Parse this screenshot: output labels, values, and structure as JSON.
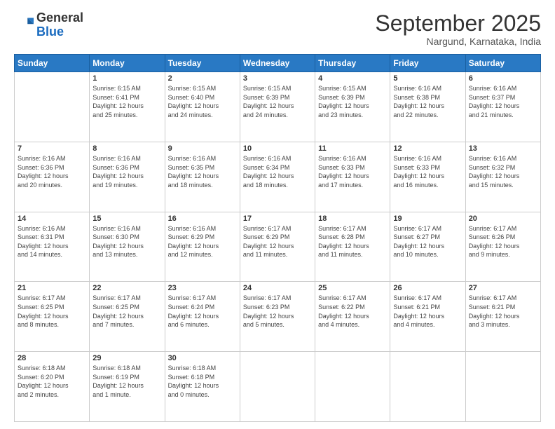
{
  "header": {
    "logo_general": "General",
    "logo_blue": "Blue",
    "month_title": "September 2025",
    "subtitle": "Nargund, Karnataka, India"
  },
  "weekdays": [
    "Sunday",
    "Monday",
    "Tuesday",
    "Wednesday",
    "Thursday",
    "Friday",
    "Saturday"
  ],
  "weeks": [
    [
      {
        "day": "",
        "info": ""
      },
      {
        "day": "1",
        "info": "Sunrise: 6:15 AM\nSunset: 6:41 PM\nDaylight: 12 hours\nand 25 minutes."
      },
      {
        "day": "2",
        "info": "Sunrise: 6:15 AM\nSunset: 6:40 PM\nDaylight: 12 hours\nand 24 minutes."
      },
      {
        "day": "3",
        "info": "Sunrise: 6:15 AM\nSunset: 6:39 PM\nDaylight: 12 hours\nand 24 minutes."
      },
      {
        "day": "4",
        "info": "Sunrise: 6:15 AM\nSunset: 6:39 PM\nDaylight: 12 hours\nand 23 minutes."
      },
      {
        "day": "5",
        "info": "Sunrise: 6:16 AM\nSunset: 6:38 PM\nDaylight: 12 hours\nand 22 minutes."
      },
      {
        "day": "6",
        "info": "Sunrise: 6:16 AM\nSunset: 6:37 PM\nDaylight: 12 hours\nand 21 minutes."
      }
    ],
    [
      {
        "day": "7",
        "info": "Sunrise: 6:16 AM\nSunset: 6:36 PM\nDaylight: 12 hours\nand 20 minutes."
      },
      {
        "day": "8",
        "info": "Sunrise: 6:16 AM\nSunset: 6:36 PM\nDaylight: 12 hours\nand 19 minutes."
      },
      {
        "day": "9",
        "info": "Sunrise: 6:16 AM\nSunset: 6:35 PM\nDaylight: 12 hours\nand 18 minutes."
      },
      {
        "day": "10",
        "info": "Sunrise: 6:16 AM\nSunset: 6:34 PM\nDaylight: 12 hours\nand 18 minutes."
      },
      {
        "day": "11",
        "info": "Sunrise: 6:16 AM\nSunset: 6:33 PM\nDaylight: 12 hours\nand 17 minutes."
      },
      {
        "day": "12",
        "info": "Sunrise: 6:16 AM\nSunset: 6:33 PM\nDaylight: 12 hours\nand 16 minutes."
      },
      {
        "day": "13",
        "info": "Sunrise: 6:16 AM\nSunset: 6:32 PM\nDaylight: 12 hours\nand 15 minutes."
      }
    ],
    [
      {
        "day": "14",
        "info": "Sunrise: 6:16 AM\nSunset: 6:31 PM\nDaylight: 12 hours\nand 14 minutes."
      },
      {
        "day": "15",
        "info": "Sunrise: 6:16 AM\nSunset: 6:30 PM\nDaylight: 12 hours\nand 13 minutes."
      },
      {
        "day": "16",
        "info": "Sunrise: 6:16 AM\nSunset: 6:29 PM\nDaylight: 12 hours\nand 12 minutes."
      },
      {
        "day": "17",
        "info": "Sunrise: 6:17 AM\nSunset: 6:29 PM\nDaylight: 12 hours\nand 11 minutes."
      },
      {
        "day": "18",
        "info": "Sunrise: 6:17 AM\nSunset: 6:28 PM\nDaylight: 12 hours\nand 11 minutes."
      },
      {
        "day": "19",
        "info": "Sunrise: 6:17 AM\nSunset: 6:27 PM\nDaylight: 12 hours\nand 10 minutes."
      },
      {
        "day": "20",
        "info": "Sunrise: 6:17 AM\nSunset: 6:26 PM\nDaylight: 12 hours\nand 9 minutes."
      }
    ],
    [
      {
        "day": "21",
        "info": "Sunrise: 6:17 AM\nSunset: 6:25 PM\nDaylight: 12 hours\nand 8 minutes."
      },
      {
        "day": "22",
        "info": "Sunrise: 6:17 AM\nSunset: 6:25 PM\nDaylight: 12 hours\nand 7 minutes."
      },
      {
        "day": "23",
        "info": "Sunrise: 6:17 AM\nSunset: 6:24 PM\nDaylight: 12 hours\nand 6 minutes."
      },
      {
        "day": "24",
        "info": "Sunrise: 6:17 AM\nSunset: 6:23 PM\nDaylight: 12 hours\nand 5 minutes."
      },
      {
        "day": "25",
        "info": "Sunrise: 6:17 AM\nSunset: 6:22 PM\nDaylight: 12 hours\nand 4 minutes."
      },
      {
        "day": "26",
        "info": "Sunrise: 6:17 AM\nSunset: 6:21 PM\nDaylight: 12 hours\nand 4 minutes."
      },
      {
        "day": "27",
        "info": "Sunrise: 6:17 AM\nSunset: 6:21 PM\nDaylight: 12 hours\nand 3 minutes."
      }
    ],
    [
      {
        "day": "28",
        "info": "Sunrise: 6:18 AM\nSunset: 6:20 PM\nDaylight: 12 hours\nand 2 minutes."
      },
      {
        "day": "29",
        "info": "Sunrise: 6:18 AM\nSunset: 6:19 PM\nDaylight: 12 hours\nand 1 minute."
      },
      {
        "day": "30",
        "info": "Sunrise: 6:18 AM\nSunset: 6:18 PM\nDaylight: 12 hours\nand 0 minutes."
      },
      {
        "day": "",
        "info": ""
      },
      {
        "day": "",
        "info": ""
      },
      {
        "day": "",
        "info": ""
      },
      {
        "day": "",
        "info": ""
      }
    ]
  ]
}
